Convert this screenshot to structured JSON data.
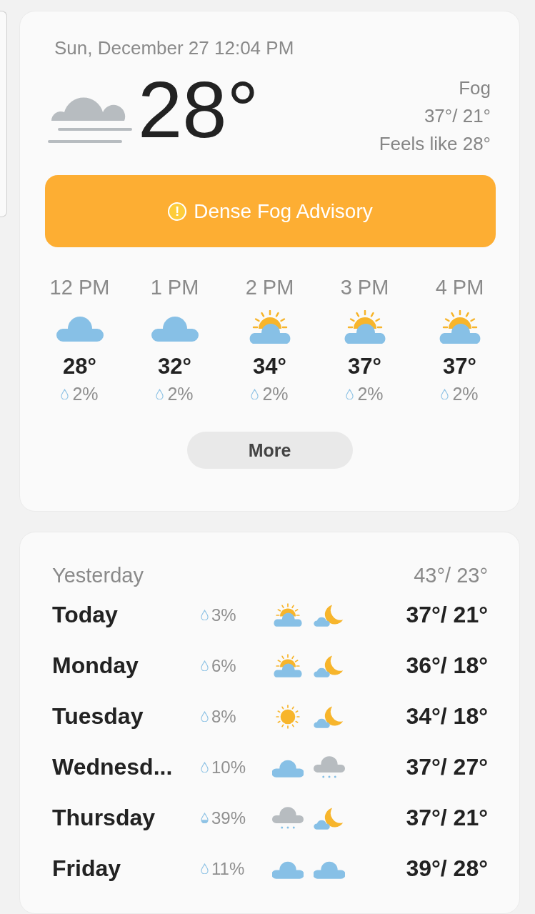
{
  "current": {
    "datetime": "Sun, December 27 12:04 PM",
    "kind": "fog",
    "temperature": "28°",
    "condition": "Fog",
    "high_low": "37°/ 21°",
    "feels_like": "Feels like 28°"
  },
  "advisory": {
    "icon": "!",
    "label": "Dense Fog Advisory"
  },
  "hourly": [
    {
      "time": "12 PM",
      "kind": "cloudy",
      "temperature": "28°",
      "precipitation": "2%"
    },
    {
      "time": "1 PM",
      "kind": "cloudy",
      "temperature": "32°",
      "precipitation": "2%"
    },
    {
      "time": "2 PM",
      "kind": "partly-sunny",
      "temperature": "34°",
      "precipitation": "2%"
    },
    {
      "time": "3 PM",
      "kind": "partly-sunny",
      "temperature": "37°",
      "precipitation": "2%"
    },
    {
      "time": "4 PM",
      "kind": "partly-sunny",
      "temperature": "37°",
      "precipitation": "2%"
    }
  ],
  "more_button": "More",
  "yesterday": {
    "label": "Yesterday",
    "high_low": "43°/ 23°"
  },
  "daily": [
    {
      "day": "Today",
      "precipitation": "3%",
      "drop_half_filled": false,
      "icons": [
        {
          "kind": "partly-sunny"
        },
        {
          "kind": "night-partly-cloudy"
        }
      ],
      "high_low": "37°/ 21°"
    },
    {
      "day": "Monday",
      "precipitation": "6%",
      "drop_half_filled": false,
      "icons": [
        {
          "kind": "partly-sunny"
        },
        {
          "kind": "night-partly-cloudy"
        }
      ],
      "high_low": "36°/ 18°"
    },
    {
      "day": "Tuesday",
      "precipitation": "8%",
      "drop_half_filled": false,
      "icons": [
        {
          "kind": "sunny"
        },
        {
          "kind": "night-partly-cloudy"
        }
      ],
      "high_low": "34°/ 18°"
    },
    {
      "day": "Wednesd...",
      "precipitation": "10%",
      "drop_half_filled": false,
      "icons": [
        {
          "kind": "cloudy"
        },
        {
          "kind": "snow"
        }
      ],
      "high_low": "37°/ 27°"
    },
    {
      "day": "Thursday",
      "precipitation": "39%",
      "drop_half_filled": true,
      "icons": [
        {
          "kind": "snow"
        },
        {
          "kind": "night-partly-cloudy"
        }
      ],
      "high_low": "37°/ 21°"
    },
    {
      "day": "Friday",
      "precipitation": "11%",
      "drop_half_filled": false,
      "icons": [
        {
          "kind": "cloudy"
        },
        {
          "kind": "cloudy"
        }
      ],
      "high_low": "39°/ 28°"
    }
  ]
}
